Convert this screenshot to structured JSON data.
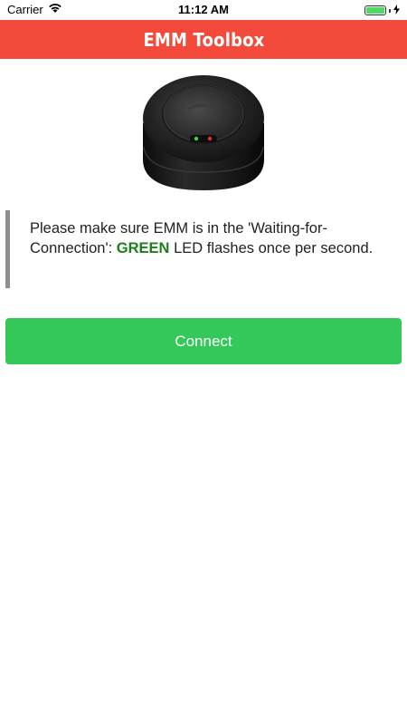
{
  "status_bar": {
    "carrier": "Carrier",
    "time": "11:12 AM",
    "wifi_icon": "wifi-icon",
    "battery_icon": "battery-icon",
    "charging_icon": "charging-bolt-icon"
  },
  "nav": {
    "title": "EMM Toolbox",
    "background_color": "#f34a3b"
  },
  "device_image": {
    "icon": "emm-device-image"
  },
  "instruction": {
    "text_before": "Please make sure EMM is in the 'Waiting-for-Connection': ",
    "highlight": "GREEN",
    "text_after": " LED flashes once per second.",
    "highlight_color": "#1e7e1e"
  },
  "connect_button": {
    "label": "Connect",
    "color": "#34c759"
  }
}
